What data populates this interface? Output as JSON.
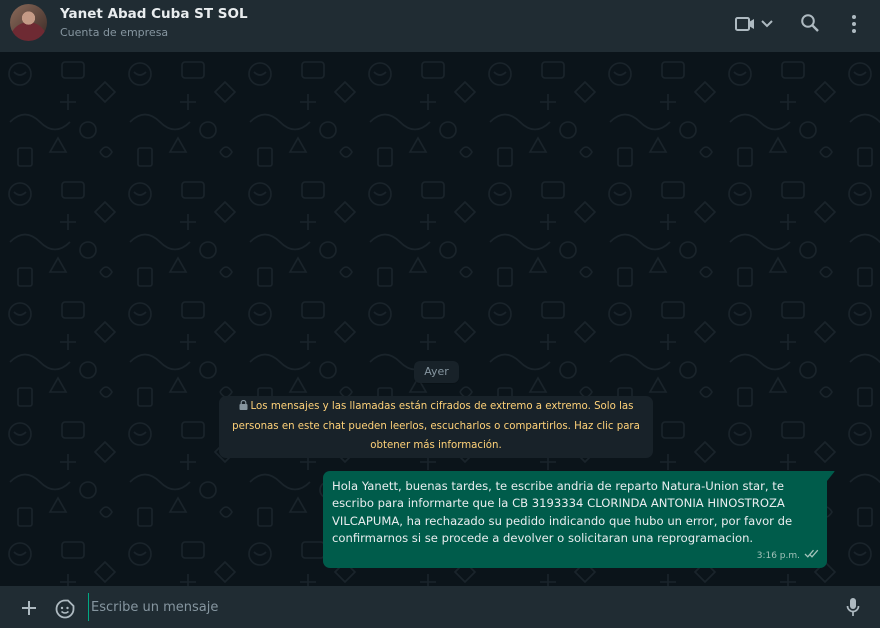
{
  "header": {
    "contact_name": "Yanet Abad Cuba ST SOL",
    "contact_subtitle": "Cuenta de empresa",
    "icons": [
      "video-call-icon",
      "chevron-down-icon",
      "search-icon",
      "menu-icon"
    ]
  },
  "chat": {
    "date_label": "Ayer",
    "encryption_notice": "Los mensajes y las llamadas están cifrados de extremo a extremo. Solo las personas en este chat pueden leerlos, escucharlos o compartirlos. Haz clic para obtener más información.",
    "messages": [
      {
        "direction": "outgoing",
        "text": "Hola Yanett, buenas tardes, te escribe andria de reparto Natura-Union star, te escribo para informarte que la CB 3193334 CLORINDA ANTONIA HINOSTROZA VILCAPUMA, ha rechazado su pedido indicando que hubo un error, por favor de confirmarnos si se procede a devolver o solicitaran una reprogramacion.",
        "time": "3:16 p.m.",
        "status": "read"
      }
    ]
  },
  "composer": {
    "placeholder": "Escribe un mensaje",
    "icons": [
      "plus-icon",
      "sticker-icon",
      "microphone-icon"
    ]
  },
  "colors": {
    "header_bg": "#202c33",
    "chat_bg": "#0b141a",
    "outgoing_bubble": "#005c4b",
    "system_chip": "#182229",
    "encryption_text": "#ffd279",
    "accent": "#00a884"
  }
}
